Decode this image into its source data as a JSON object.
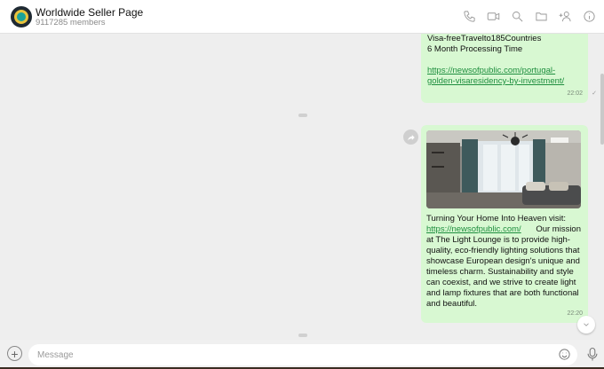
{
  "header": {
    "title": "Worldwide Seller Page",
    "members": "9117285 members",
    "icons": [
      "phone-icon",
      "video-icon",
      "search-icon",
      "folder-icon",
      "add-user-icon",
      "info-icon"
    ]
  },
  "messages": [
    {
      "lines": [
        "Visa-freeTravelto185Countries",
        "6 Month Processing Time"
      ],
      "link": "https://newsofpublic.com/portugal-golden-visaresidency-by-investment/",
      "time": "22:02"
    },
    {
      "image": "living-room-photo",
      "text_before_link": "Turning Your Home Into Heaven   visit:",
      "link": "https://newsofpublic.com/",
      "text_after_link": "Our mission at The Light Lounge is to provide high-quality, eco-friendly lighting solutions that showcase European design's unique and timeless charm. Sustainability and style can coexist, and we strive to create light and lamp fixtures that are both functional and beautiful.",
      "time": "22:20"
    }
  ],
  "input": {
    "placeholder": "Message"
  },
  "colors": {
    "bubble": "#d8f8d2",
    "link": "#1e8e3e",
    "background": "#eeeeee"
  }
}
